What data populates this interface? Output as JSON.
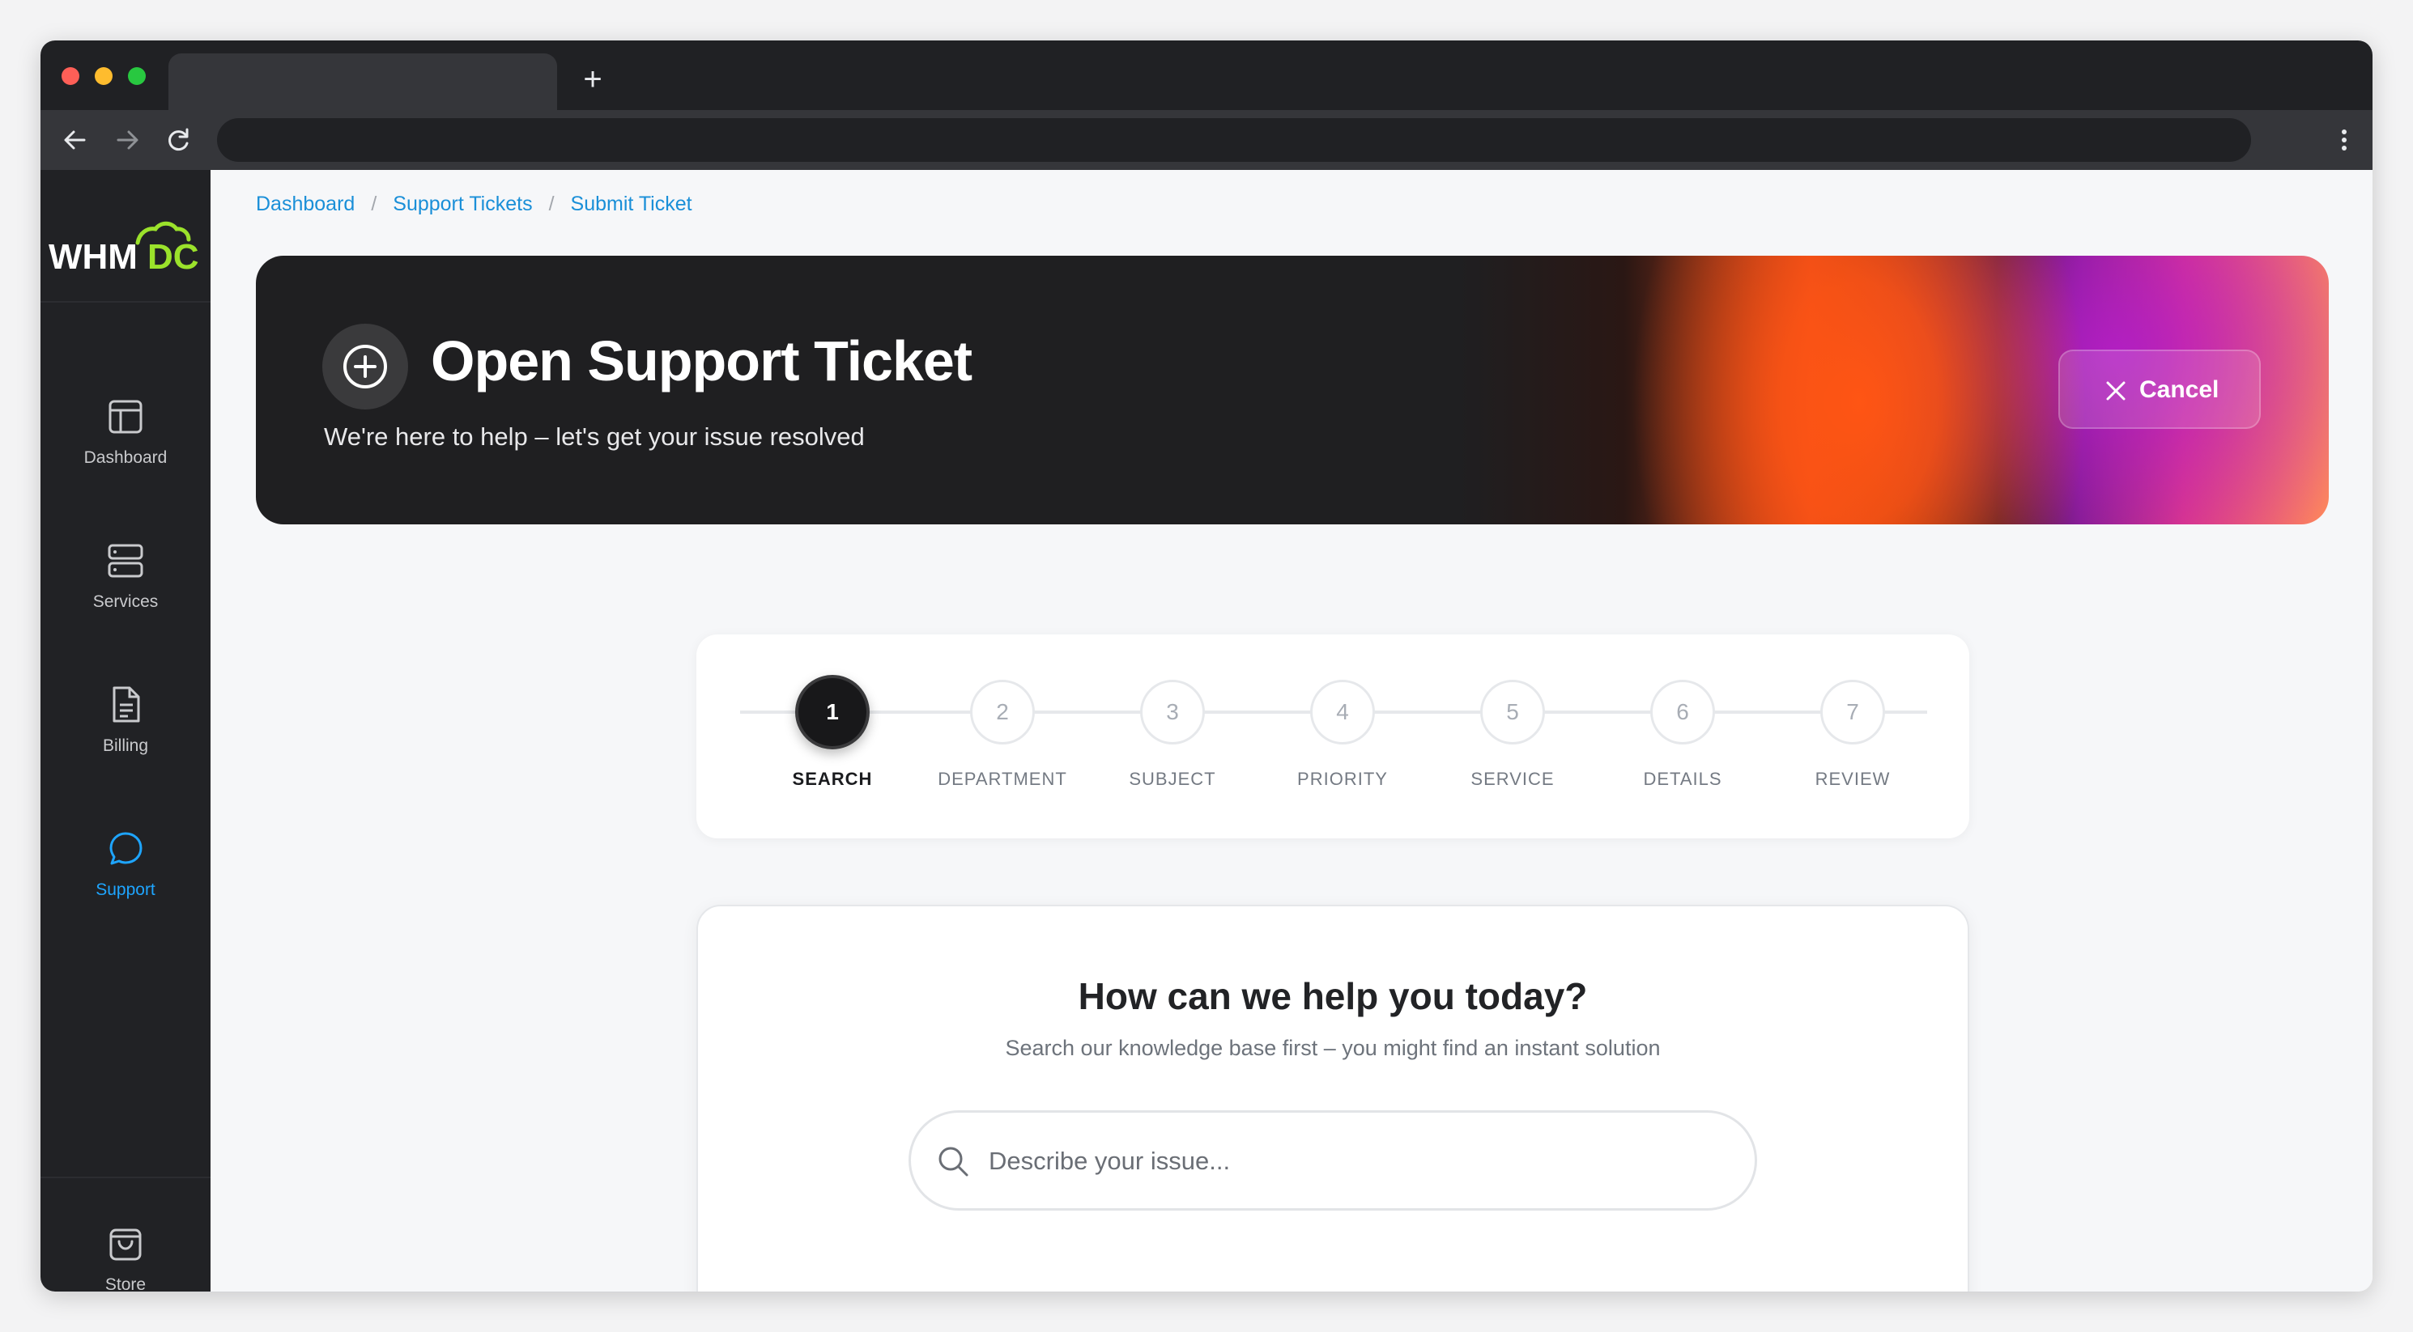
{
  "browser": {
    "new_tab_icon": "plus-icon",
    "back_icon": "arrow-left-icon",
    "forward_icon": "arrow-right-icon",
    "reload_icon": "reload-icon",
    "menu_icon": "kebab-menu-icon"
  },
  "logo": {
    "text_white": "WHM",
    "text_green": "DC",
    "brand_green": "#9be22b"
  },
  "sidebar": {
    "items": [
      {
        "label": "Dashboard",
        "icon": "layout-icon"
      },
      {
        "label": "Services",
        "icon": "server-icon"
      },
      {
        "label": "Billing",
        "icon": "document-icon"
      },
      {
        "label": "Support",
        "icon": "chat-bubble-icon",
        "active": true
      },
      {
        "label": "Store",
        "icon": "shopping-bag-icon"
      }
    ]
  },
  "breadcrumb": {
    "items": [
      "Dashboard",
      "Support Tickets",
      "Submit Ticket"
    ],
    "separator": "/"
  },
  "hero": {
    "title": "Open Support Ticket",
    "subtitle": "We're here to help – let's get your issue resolved",
    "cancel_label": "Cancel"
  },
  "stepper": {
    "current": 1,
    "steps": [
      {
        "number": "1",
        "label": "SEARCH"
      },
      {
        "number": "2",
        "label": "DEPARTMENT"
      },
      {
        "number": "3",
        "label": "SUBJECT"
      },
      {
        "number": "4",
        "label": "PRIORITY"
      },
      {
        "number": "5",
        "label": "SERVICE"
      },
      {
        "number": "6",
        "label": "DETAILS"
      },
      {
        "number": "7",
        "label": "REVIEW"
      }
    ]
  },
  "search_card": {
    "title": "How can we help you today?",
    "subtitle": "Search our knowledge base first – you might find an instant solution",
    "input_value": "",
    "input_placeholder": "Describe your issue..."
  },
  "colors": {
    "accent_blue": "#1ea5ff",
    "sidebar_bg": "#212225",
    "hero_bg": "#1f1f21"
  }
}
